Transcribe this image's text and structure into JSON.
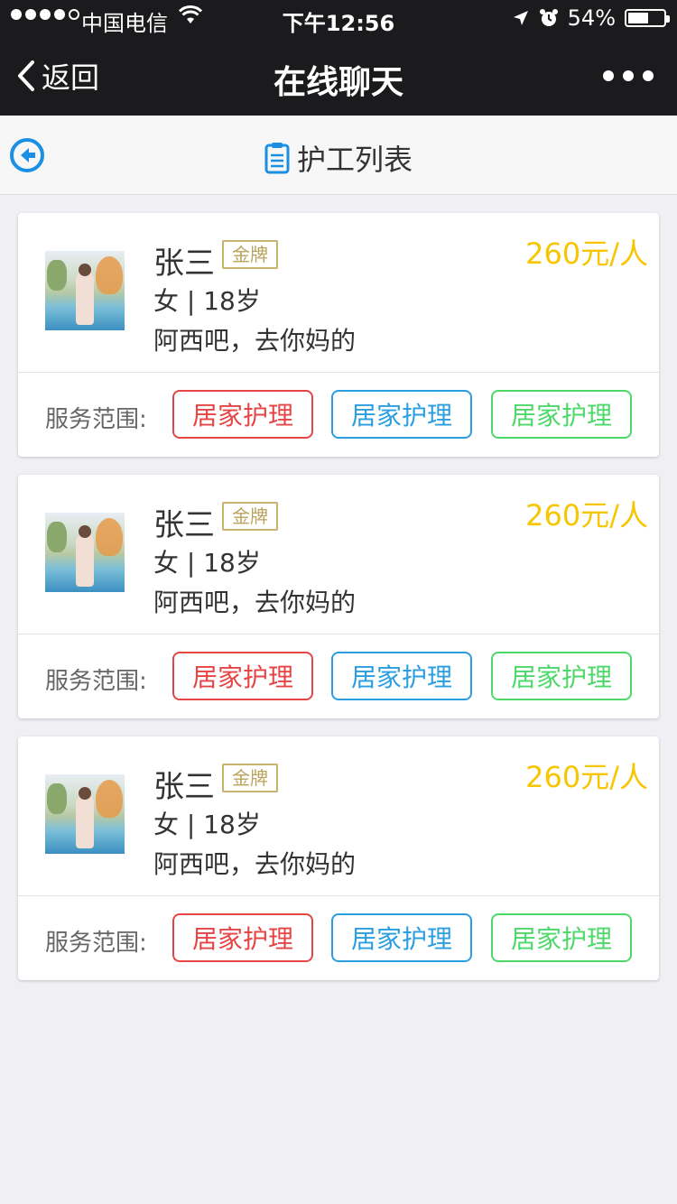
{
  "status_bar": {
    "carrier": "中国电信",
    "time": "下午12:56",
    "battery": "54%",
    "battery_level": 0.54
  },
  "nav": {
    "back_label": "返回",
    "title": "在线聊天"
  },
  "sub_header": {
    "title": "护工列表"
  },
  "caregivers": [
    {
      "name": "张三",
      "badge": "金牌",
      "price": "260元/人",
      "info": "女 | 18岁",
      "desc": "阿西吧，去你妈的",
      "scope_label": "服务范围:",
      "tags": [
        "居家护理",
        "居家护理",
        "居家护理"
      ]
    },
    {
      "name": "张三",
      "badge": "金牌",
      "price": "260元/人",
      "info": "女 | 18岁",
      "desc": "阿西吧，去你妈的",
      "scope_label": "服务范围:",
      "tags": [
        "居家护理",
        "居家护理",
        "居家护理"
      ]
    },
    {
      "name": "张三",
      "badge": "金牌",
      "price": "260元/人",
      "info": "女 | 18岁",
      "desc": "阿西吧，去你妈的",
      "scope_label": "服务范围:",
      "tags": [
        "居家护理",
        "居家护理",
        "居家护理"
      ]
    }
  ],
  "colors": {
    "price": "#f7c600",
    "badge": "#c8b36e",
    "tag_red": "#e64545",
    "tag_blue": "#2a9ee0",
    "tag_green": "#4cd96a",
    "nav_bg": "#1b1b1d",
    "accent": "#1a8fe3"
  },
  "icons": {
    "back": "chevron-left-icon",
    "more": "more-dots-icon",
    "sub_back": "circle-arrow-left-icon",
    "list": "clipboard-list-icon"
  }
}
